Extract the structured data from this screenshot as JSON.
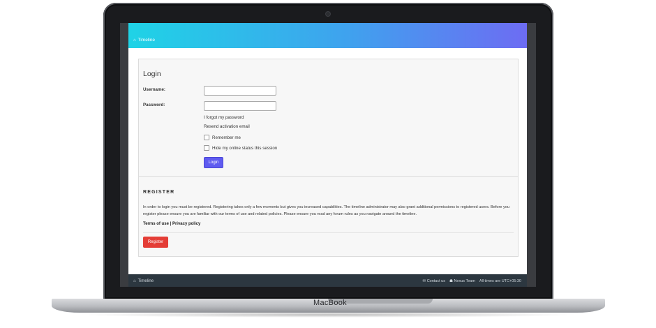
{
  "device": {
    "label": "MacBook"
  },
  "navbar": {
    "home_link": "Timeline"
  },
  "login": {
    "title": "Login",
    "username_label": "Username:",
    "password_label": "Password:",
    "forgot_password": "I forgot my password",
    "resend_activation": "Resend activation email",
    "remember_me": "Remember me",
    "hide_online": "Hide my online status this session",
    "login_button": "Login"
  },
  "register": {
    "title": "REGISTER",
    "text": "In order to login you must be registered. Registering takes only a few moments but gives you increased capabilities. The timeline administrator may also grant additional permissions to registered users. Before you register please ensure you are familiar with our terms of use and related policies. Please ensure you read any forum rules as you navigate around the timeline.",
    "terms_of_use": "Terms of use",
    "separator": "|",
    "privacy_policy": "Privacy policy",
    "register_button": "Register"
  },
  "footer": {
    "home_link": "Timeline",
    "contact": "Contact us",
    "team": "Nexus Team",
    "times": "All times are UTC+05:30"
  }
}
